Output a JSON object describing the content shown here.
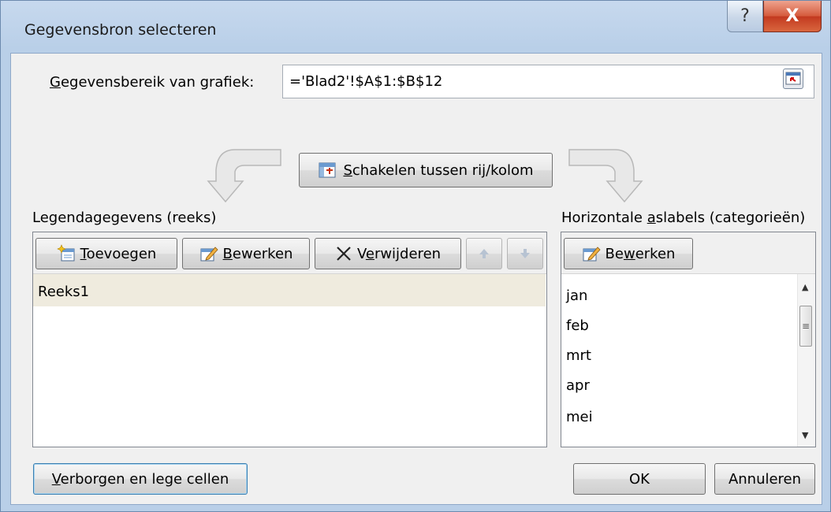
{
  "window": {
    "title": "Gegevensbron selecteren",
    "help_glyph": "?",
    "close_glyph": "X"
  },
  "range": {
    "label_prefix": "G",
    "label_rest": "egevensbereik van grafiek:",
    "value": "='Blad2'!$A$1:$B$12"
  },
  "switch_button": {
    "label_prefix": "S",
    "label_rest": "chakelen tussen rij/kolom"
  },
  "legend": {
    "heading": "Legendagegevens (reeks)",
    "add": {
      "prefix": "T",
      "rest": "oevoegen"
    },
    "edit": {
      "prefix": "B",
      "rest": "ewerken"
    },
    "remove": {
      "pre": "V",
      "u": "e",
      "rest": "rwijderen"
    },
    "items": [
      "Reeks1"
    ]
  },
  "categories": {
    "heading_pre": "Horizontale ",
    "heading_u": "a",
    "heading_rest": "slabels (categorieën)",
    "edit": {
      "pre": "Be",
      "u": "w",
      "rest": "erken"
    },
    "items": [
      "jan",
      "feb",
      "mrt",
      "apr",
      "mei"
    ]
  },
  "footer": {
    "hidden_prefix": "V",
    "hidden_rest": "erborgen en lege cellen",
    "ok": "OK",
    "cancel": "Annuleren"
  },
  "icons": {
    "collapse": "range-collapse-icon",
    "switch": "switch-rows-columns-icon",
    "add": "add-series-icon",
    "edit": "edit-pencil-icon",
    "remove": "delete-x-icon",
    "up": "move-up-icon",
    "down": "move-down-icon"
  },
  "colors": {
    "selection": "#efebde",
    "close_red": "#c2391f",
    "title_gradient": "#c7d9ee"
  }
}
